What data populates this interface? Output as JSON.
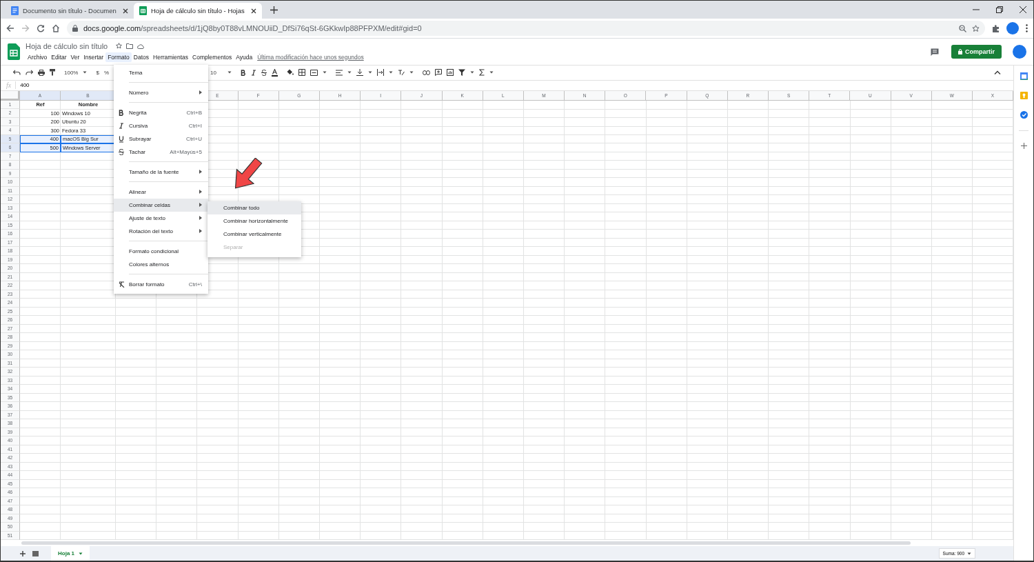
{
  "browser": {
    "tabs": [
      {
        "title": "Documento sin título - Documen",
        "kind": "doc",
        "selected": false
      },
      {
        "title": "Hoja de cálculo sin título - Hojas",
        "kind": "sheet",
        "selected": true
      }
    ],
    "url_host": "docs.google.com",
    "url_path": "/spreadsheets/d/1jQ8by0T88vLMNOUiiD_DfSi76qSt-6GKkwIp88PFPXM/edit#gid=0"
  },
  "document": {
    "title": "Hoja de cálculo sin título",
    "menus": [
      {
        "label": "Archivo",
        "selected": false
      },
      {
        "label": "Editar",
        "selected": false
      },
      {
        "label": "Ver",
        "selected": false
      },
      {
        "label": "Insertar",
        "selected": false
      },
      {
        "label": "Formato",
        "selected": true
      },
      {
        "label": "Datos",
        "selected": false
      },
      {
        "label": "Herramientas",
        "selected": false
      },
      {
        "label": "Complementos",
        "selected": false
      },
      {
        "label": "Ayuda",
        "selected": false
      }
    ],
    "last_modified": "Última modificación hace unos segundos",
    "share_button": "Compartir"
  },
  "toolbar": {
    "zoom": "100%",
    "currency": "$",
    "percent": "%",
    "font_size": "10"
  },
  "formula_bar": {
    "fx": "fx",
    "value": "400"
  },
  "sheet": {
    "columns": [
      {
        "label": "A",
        "selected": true
      },
      {
        "label": "B",
        "selected": true
      },
      {},
      {},
      {
        "label": "E",
        "selected": false
      },
      {
        "label": "F",
        "selected": false
      },
      {
        "label": "G",
        "selected": false
      },
      {
        "label": "H",
        "selected": false
      },
      {
        "label": "I",
        "selected": false
      },
      {
        "label": "J",
        "selected": false
      },
      {
        "label": "K",
        "selected": false
      },
      {
        "label": "L",
        "selected": false
      },
      {
        "label": "M",
        "selected": false
      },
      {
        "label": "N",
        "selected": false
      },
      {
        "label": "O",
        "selected": false
      },
      {
        "label": "P",
        "selected": false
      },
      {
        "label": "Q",
        "selected": false
      },
      {
        "label": "R",
        "selected": false
      },
      {
        "label": "S",
        "selected": false
      },
      {
        "label": "T",
        "selected": false
      },
      {
        "label": "U",
        "selected": false
      },
      {
        "label": "V",
        "selected": false
      },
      {
        "label": "W",
        "selected": false
      },
      {
        "label": "X",
        "selected": false
      }
    ],
    "rows": [
      {
        "label": "1",
        "kind": "header",
        "selected": false,
        "cells": [
          "Ref",
          "Nombre"
        ]
      },
      {
        "label": "2",
        "kind": "data",
        "selected": false,
        "cells": [
          "100",
          "Windows 10"
        ]
      },
      {
        "label": "3",
        "kind": "data",
        "selected": false,
        "cells": [
          "200",
          "Ubuntu 20"
        ]
      },
      {
        "label": "4",
        "kind": "data",
        "selected": false,
        "cells": [
          "300",
          "Fedora 33"
        ]
      },
      {
        "label": "5",
        "kind": "data",
        "selected": true,
        "cells": [
          "400",
          "macOS Big Sur"
        ]
      },
      {
        "label": "6",
        "kind": "data",
        "selected": true,
        "cells": [
          "500",
          "Windows Server"
        ]
      }
    ],
    "empty_rows": [
      "7",
      "8",
      "9",
      "10",
      "11",
      "12",
      "13",
      "14",
      "15",
      "16",
      "17",
      "18",
      "19",
      "20",
      "21",
      "22",
      "23",
      "24",
      "25",
      "26",
      "27",
      "28",
      "29",
      "30",
      "31",
      "32",
      "33",
      "34",
      "35",
      "36",
      "37",
      "38",
      "39",
      "40",
      "41",
      "42",
      "43",
      "44",
      "45",
      "46",
      "47",
      "48",
      "49",
      "50",
      "51"
    ]
  },
  "format_menu": [
    {
      "kind": "item",
      "label": "Tema",
      "selected": false
    },
    {
      "kind": "separator"
    },
    {
      "kind": "item",
      "label": "Número",
      "submenu": true,
      "selected": false
    },
    {
      "kind": "separator"
    },
    {
      "kind": "bold",
      "label": "Negrita",
      "shortcut": "Ctrl+B",
      "selected": false
    },
    {
      "kind": "italic",
      "label": "Cursiva",
      "shortcut": "Ctrl+I",
      "selected": false
    },
    {
      "kind": "underline",
      "label": "Subrayar",
      "shortcut": "Ctrl+U",
      "selected": false
    },
    {
      "kind": "strike",
      "label": "Tachar",
      "shortcut": "Alt+Mayús+5",
      "selected": false
    },
    {
      "kind": "separator"
    },
    {
      "kind": "item",
      "label": "Tamaño de la fuente",
      "submenu": true,
      "selected": false
    },
    {
      "kind": "separator"
    },
    {
      "kind": "item",
      "label": "Alinear",
      "submenu": true,
      "selected": false
    },
    {
      "kind": "item",
      "label": "Combinar celdas",
      "submenu": true,
      "selected": true
    },
    {
      "kind": "item",
      "label": "Ajuste de texto",
      "submenu": true,
      "selected": false
    },
    {
      "kind": "item",
      "label": "Rotación del texto",
      "submenu": true,
      "selected": false
    },
    {
      "kind": "separator"
    },
    {
      "kind": "item",
      "label": "Formato condicional",
      "selected": false
    },
    {
      "kind": "item",
      "label": "Colores alternos",
      "selected": false
    },
    {
      "kind": "separator"
    },
    {
      "kind": "clear",
      "label": "Borrar formato",
      "shortcut": "Ctrl+\\",
      "selected": false
    }
  ],
  "merge_submenu": [
    {
      "label": "Combinar todo",
      "selected": true,
      "disabled": false
    },
    {
      "label": "Combinar horizontalmente",
      "selected": false,
      "disabled": false
    },
    {
      "label": "Combinar verticalmente",
      "selected": false,
      "disabled": false
    },
    {
      "label": "Separar",
      "selected": false,
      "disabled": true
    }
  ],
  "sheet_tabs": [
    {
      "label": "Hoja 1",
      "selected": true
    }
  ],
  "sum": "Suma: 900"
}
